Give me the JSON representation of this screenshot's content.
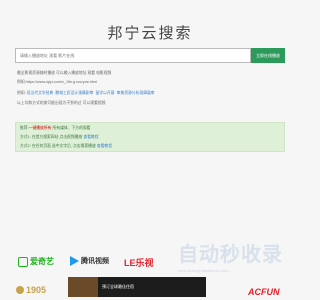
{
  "header": {
    "title": "邦宁云搜索"
  },
  "search": {
    "placeholder": "请输入播放地址 观看 影片在线",
    "button_label": "立即在线播放"
  },
  "info": {
    "line1": "最全影视资源随时播放 可以输入播放地址 观看 电影视频",
    "line2": "例如:https://www.iqiyi.com/v_19rrg.vxcryne.html",
    "line3_prefix": "例如:",
    "line3_links": [
      "现当代文学经典",
      "鹏城工匠设计观摩剧审",
      "留学以开幕",
      "审美资源分析观摩展审"
    ],
    "line4": "以上均和方式的旅可能出现为不到的过 可以观看视频"
  },
  "tips": {
    "line1_prefix": "推荐:",
    "line1_red": "一键播放所有",
    "line1_suffix": "所有媒体、下方的观看",
    "line2_prefix": "方式1:",
    "line2_text": "在首方搜索网站 点击视频播放",
    "line2_link": "查看教程",
    "line3_prefix": "方式2:",
    "line3_text": "在任何页面 选中文字后, 点击搜索播放",
    "line3_link": "查看教程"
  },
  "watermark": {
    "text": "自动秒收录",
    "subtext": "www.zidongmiaoshoulu.com"
  },
  "logos": {
    "iqiyi": "爱奇艺",
    "tencent": "腾讯视频",
    "letv": "LE乐视",
    "m1905": "1905",
    "acfun": "ACFUN"
  },
  "banner": {
    "text": "预订全球最佳住宿"
  },
  "colors": {
    "accent": "#2c9a5a",
    "link": "#3a7fc4",
    "tip_bg": "#dff0d8"
  }
}
